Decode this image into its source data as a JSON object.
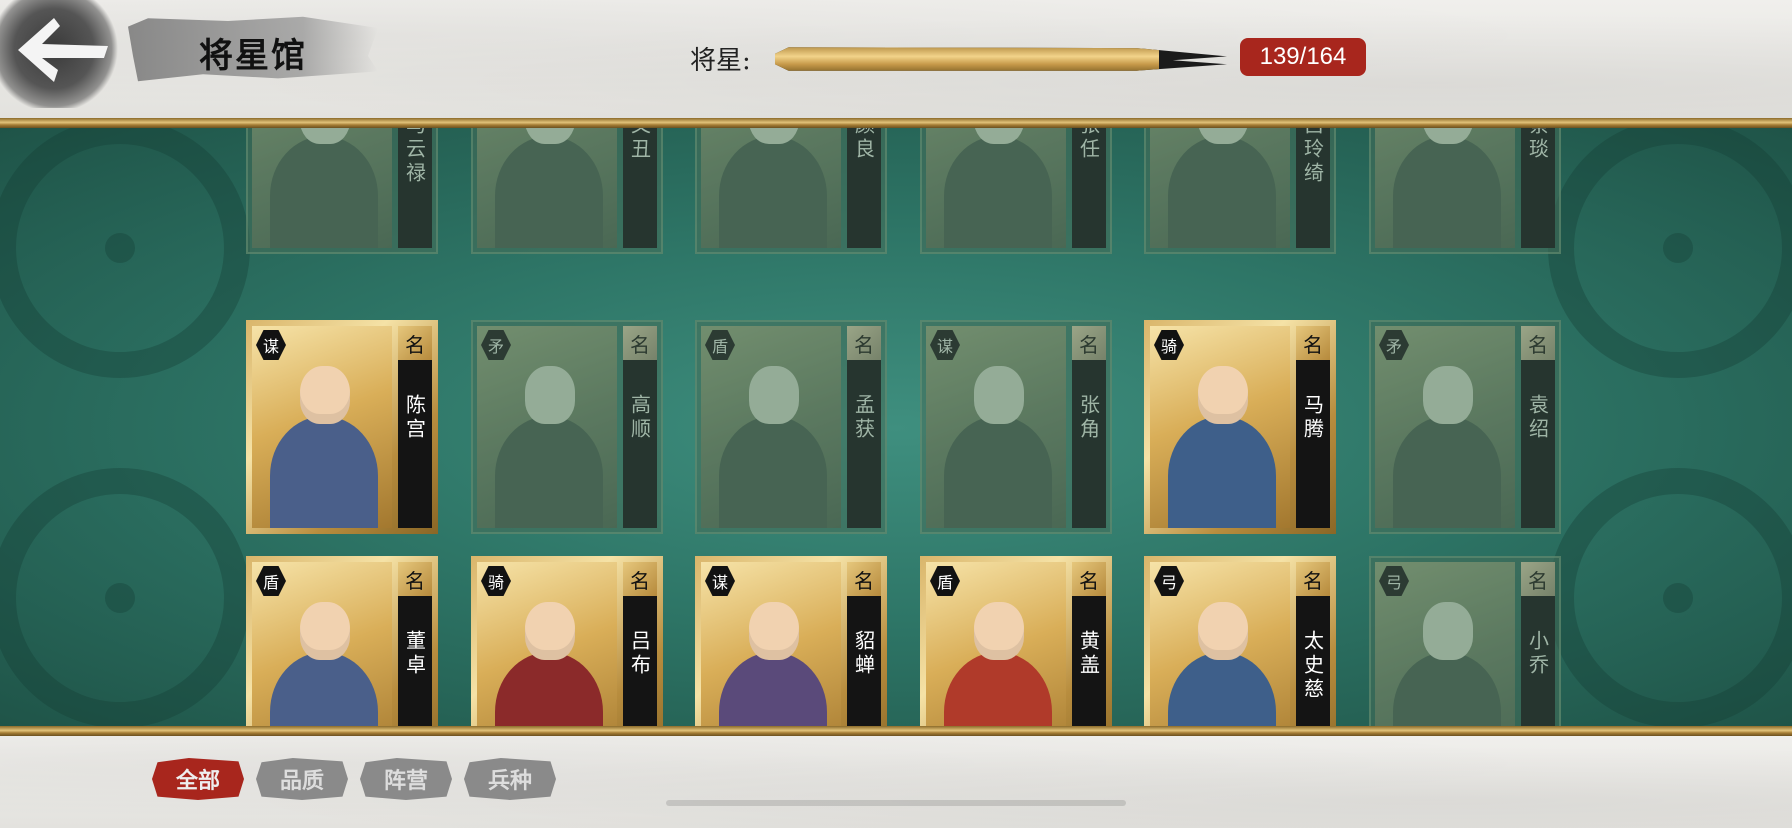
{
  "header": {
    "title": "将星馆",
    "progress_label": "将星:",
    "progress_count": "139/164",
    "progress_fraction": 0.85
  },
  "ming_label": "名",
  "cards": [
    {
      "name": "马云禄",
      "cls": "",
      "owned": false
    },
    {
      "name": "文丑",
      "cls": "",
      "owned": false
    },
    {
      "name": "颜良",
      "cls": "",
      "owned": false
    },
    {
      "name": "张任",
      "cls": "",
      "owned": false
    },
    {
      "name": "吕玲绮",
      "cls": "",
      "owned": false
    },
    {
      "name": "蔡琰",
      "cls": "",
      "owned": false
    },
    {
      "name": "陈宫",
      "cls": "谋",
      "owned": true
    },
    {
      "name": "高顺",
      "cls": "矛",
      "owned": false
    },
    {
      "name": "孟获",
      "cls": "盾",
      "owned": false
    },
    {
      "name": "张角",
      "cls": "谋",
      "owned": false
    },
    {
      "name": "马腾",
      "cls": "骑",
      "owned": true
    },
    {
      "name": "袁绍",
      "cls": "矛",
      "owned": false
    },
    {
      "name": "董卓",
      "cls": "盾",
      "owned": true
    },
    {
      "name": "吕布",
      "cls": "骑",
      "owned": true
    },
    {
      "name": "貂蝉",
      "cls": "谋",
      "owned": true
    },
    {
      "name": "黄盖",
      "cls": "盾",
      "owned": true
    },
    {
      "name": "太史慈",
      "cls": "弓",
      "owned": true
    },
    {
      "name": "小乔",
      "cls": "弓",
      "owned": false
    }
  ],
  "filters": {
    "all": "全部",
    "quality": "品质",
    "faction": "阵营",
    "troop": "兵种"
  },
  "colors": {
    "accent_red": "#a8261d",
    "board_green": "#2e7667",
    "gold": "#d9b56a"
  },
  "icons": {
    "back": "back-arrow-icon"
  }
}
